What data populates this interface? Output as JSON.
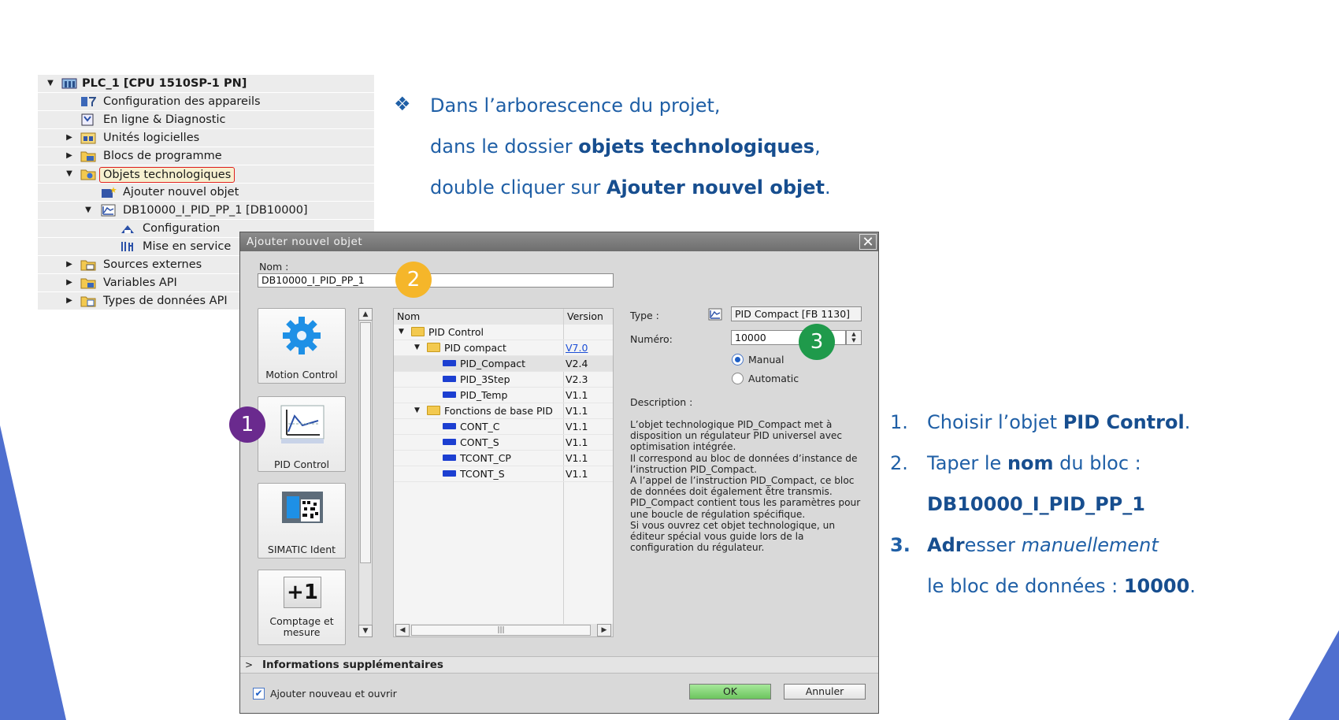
{
  "colors": {
    "accent_blue": "#1f5fa6",
    "highlight_red": "#e0201c",
    "badge_1": "#6a2a8e",
    "badge_2": "#f5b62a",
    "badge_3": "#1f9a4b",
    "ok_green": "#78d06a",
    "decor_blue": "#4f6fcf"
  },
  "tree": {
    "items": [
      {
        "label": "PLC_1 [CPU 1510SP-1 PN]",
        "icon": "plc-icon",
        "expanded": true
      },
      {
        "label": "Configuration des appareils",
        "icon": "device-config-icon"
      },
      {
        "label": "En ligne & Diagnostic",
        "icon": "diagnostic-icon"
      },
      {
        "label": "Unités logicielles",
        "icon": "software-units-icon"
      },
      {
        "label": "Blocs de programme",
        "icon": "folder-icon"
      },
      {
        "label": "Objets technologiques",
        "icon": "folder-icon",
        "highlighted": true
      },
      {
        "label": "Ajouter nouvel objet",
        "icon": "add-object-icon"
      },
      {
        "label": "DB10000_I_PID_PP_1 [DB10000]",
        "icon": "pid-icon"
      },
      {
        "label": "Configuration",
        "icon": "config-icon"
      },
      {
        "label": "Mise en service",
        "icon": "commissioning-icon"
      },
      {
        "label": "Sources externes",
        "icon": "folder-icon"
      },
      {
        "label": "Variables API",
        "icon": "folder-icon"
      },
      {
        "label": "Types de données API",
        "icon": "folder-icon"
      }
    ]
  },
  "instructions": {
    "bullet": "❖",
    "line1": "Dans l’arborescence du projet,",
    "line2_pre": "dans le dossier ",
    "line2_bold": "objets technologiques",
    "line2_post": ",",
    "line3_pre": "double cliquer sur ",
    "line3_bold": "Ajouter nouvel objet",
    "line3_post": "."
  },
  "steps": {
    "s1_num": "1.",
    "s1_pre": "Choisir l’objet ",
    "s1_bold": "PID Control",
    "s1_post": ".",
    "s2_num": "2.",
    "s2_pre": "Taper le ",
    "s2_bold": "nom",
    "s2_post": " du bloc :",
    "s2_value": "DB10000_I_PID_PP_1",
    "s3_num": "3.",
    "s3_bold": "Adr",
    "s3_mid": "esser ",
    "s3_ital": "manuellement",
    "s3b_pre": "le bloc de données : ",
    "s3b_bold": "10000",
    "s3b_post": "."
  },
  "badges": {
    "b1": "1",
    "b2": "2",
    "b3": "3"
  },
  "dialog": {
    "title": "Ajouter nouvel objet",
    "close": "✕",
    "name_label": "Nom :",
    "name_value": "DB10000_I_PID_PP_1",
    "categories": [
      "Motion Control",
      "PID Control",
      "SIMATIC Ident",
      "Comptage et mesure"
    ],
    "counter_icon_text": "+1",
    "grid": {
      "col_name": "Nom",
      "col_version": "Version",
      "rows": [
        {
          "name": "PID Control",
          "version": "",
          "level": 0,
          "kind": "folder",
          "arrow": "▼"
        },
        {
          "name": "PID compact",
          "version": "V7.0",
          "level": 1,
          "kind": "folder",
          "arrow": "▼",
          "link": true
        },
        {
          "name": "PID_Compact",
          "version": "V2.4",
          "level": 2,
          "kind": "block",
          "selected": true
        },
        {
          "name": "PID_3Step",
          "version": "V2.3",
          "level": 2,
          "kind": "block"
        },
        {
          "name": "PID_Temp",
          "version": "V1.1",
          "level": 2,
          "kind": "block"
        },
        {
          "name": "Fonctions de base PID",
          "version": "V1.1",
          "level": 1,
          "kind": "folder",
          "arrow": "▼"
        },
        {
          "name": "CONT_C",
          "version": "V1.1",
          "level": 2,
          "kind": "block"
        },
        {
          "name": "CONT_S",
          "version": "V1.1",
          "level": 2,
          "kind": "block"
        },
        {
          "name": "TCONT_CP",
          "version": "V1.1",
          "level": 2,
          "kind": "block"
        },
        {
          "name": "TCONT_S",
          "version": "V1.1",
          "level": 2,
          "kind": "block"
        }
      ],
      "hscroll_grip": "|||"
    },
    "type_label": "Type :",
    "type_value": "PID Compact [FB 1130]",
    "numero_label": "Numéro:",
    "numero_value": "10000",
    "radio_manual": "Manual",
    "radio_auto": "Automatic",
    "description_label": "Description :",
    "description_p1": "L’objet technologique PID_Compact met à disposition un régulateur PID universel avec optimisation intégrée.",
    "description_p2": "Il correspond au bloc de données d’instance de l’instruction PID_Compact.",
    "description_p3": "A l’appel de l’instruction PID_Compact, ce bloc de données doit également être transmis.",
    "description_p4": "PID_Compact contient tous les paramètres pour une boucle de régulation spécifique.",
    "description_p5": "Si vous ouvrez cet objet technologique, un éditeur spécial vous guide lors de la configuration du régulateur.",
    "more_info": "Informations supplémentaires",
    "add_open": "Ajouter nouveau et ouvrir",
    "ok": "OK",
    "cancel": "Annuler"
  }
}
